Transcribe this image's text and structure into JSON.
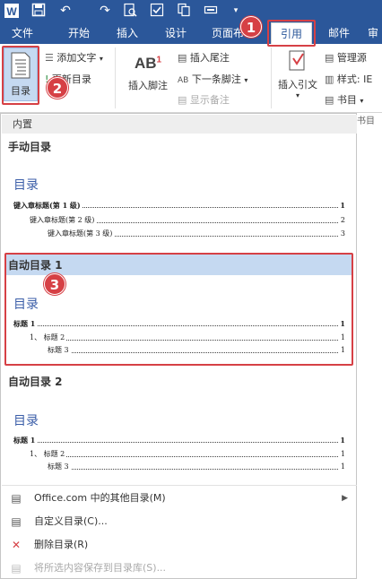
{
  "colors": {
    "brand": "#2b579a",
    "highlight": "#c5d9f1",
    "annotation": "#d64045"
  },
  "quick_access": [
    "word-icon",
    "save-icon",
    "undo-icon",
    "redo-icon",
    "print-preview-icon",
    "check-icon",
    "copy-icon",
    "more-icon"
  ],
  "tabs": [
    {
      "label": "文件"
    },
    {
      "label": "开始"
    },
    {
      "label": "插入"
    },
    {
      "label": "设计"
    },
    {
      "label": "页面布"
    },
    {
      "label": "引用"
    },
    {
      "label": "邮件"
    },
    {
      "label": "审"
    }
  ],
  "ribbon": {
    "toc_button": "目录",
    "add_text": "添加文字",
    "update_toc": "更新目录",
    "insert_footnote": "插入脚注",
    "insert_endnote": "插入尾注",
    "next_footnote": "下一条脚注",
    "show_notes": "显示备注",
    "insert_citation": "插入引文",
    "manage_sources": "管理源",
    "style_label": "样式:",
    "style_value": "IE",
    "bibliography": "书目",
    "group_label": "书目"
  },
  "annotations": {
    "b1": "1",
    "b2": "2",
    "b3": "3"
  },
  "menu": {
    "header": "内置",
    "galleries": [
      {
        "title": "手动目录",
        "toc_title": "目录",
        "entries": [
          {
            "text": "键入章标题(第 1 级)",
            "page": "1"
          },
          {
            "text": "键入章标题(第 2 级)",
            "page": "2"
          },
          {
            "text": "键入章标题(第 3 级)",
            "page": "3"
          }
        ]
      },
      {
        "title": "自动目录 1",
        "toc_title": "目录",
        "entries": [
          {
            "text": "标题 1",
            "page": "1"
          },
          {
            "text": "1、 标题 2",
            "page": "1"
          },
          {
            "text": "标题 3",
            "page": "1"
          }
        ]
      },
      {
        "title": "自动目录 2",
        "toc_title": "目录",
        "entries": [
          {
            "text": "标题 1",
            "page": "1"
          },
          {
            "text": "1、 标题 2",
            "page": "1"
          },
          {
            "text": "标题 3",
            "page": "1"
          }
        ]
      }
    ],
    "commands": [
      {
        "label": "Office.com 中的其他目录(M)"
      },
      {
        "label": "自定义目录(C)..."
      },
      {
        "label": "删除目录(R)"
      },
      {
        "label": "将所选内容保存到目录库(S)..."
      }
    ]
  }
}
